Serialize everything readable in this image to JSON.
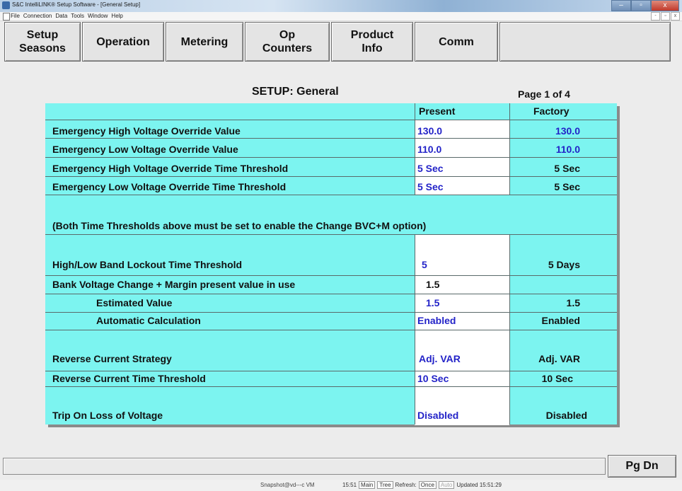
{
  "window": {
    "title": "S&C IntelliLINK® Setup Software - [General Setup]",
    "controls": [
      "–",
      "▫",
      "x"
    ]
  },
  "menu": {
    "items": [
      "File",
      "Connection",
      "Data",
      "Tools",
      "Window",
      "Help"
    ],
    "mdi_controls": [
      "-",
      "▫",
      "x"
    ]
  },
  "toolbar": {
    "buttons": [
      "Setup\nSeasons",
      "Operation",
      "Metering",
      "Op\nCounters",
      "Product\nInfo",
      "Comm",
      ""
    ]
  },
  "page": {
    "title": "SETUP: General",
    "page_indicator": "Page 1 of 4"
  },
  "table": {
    "col_present": "Present",
    "col_factory": "Factory",
    "rows": [
      {
        "label": "Emergency High Voltage Override Value",
        "present": "130.0",
        "factory": "130.0"
      },
      {
        "label": "Emergency Low Voltage Override Value",
        "present": "110.0",
        "factory": "110.0"
      },
      {
        "label": "Emergency High Voltage Override Time Threshold",
        "present": "5 Sec",
        "factory": "5 Sec"
      },
      {
        "label": "Emergency Low Voltage Override Time Threshold",
        "present": "5 Sec",
        "factory": "5 Sec"
      },
      {
        "label": "(Both Time Thresholds above must be set to enable the Change BVC+M option)"
      },
      {
        "label": "High/Low Band Lockout Time Threshold",
        "present": "5",
        "factory": "5 Days"
      },
      {
        "label": "Bank Voltage Change + Margin present value in use",
        "present": "1.5",
        "factory": ""
      },
      {
        "label": "Estimated Value",
        "present": "1.5",
        "factory": "1.5"
      },
      {
        "label": "Automatic Calculation",
        "present": "Enabled",
        "factory": "Enabled"
      },
      {
        "label": "Reverse Current Strategy",
        "present": "Adj. VAR",
        "factory": "Adj. VAR"
      },
      {
        "label": "Reverse Current Time Threshold",
        "present": "10 Sec",
        "factory": "10 Sec"
      },
      {
        "label": "Trip On Loss of Voltage",
        "present": "Disabled",
        "factory": "Disabled"
      }
    ]
  },
  "footer": {
    "status": "",
    "pgdn_label": "Pg Dn"
  },
  "bottom_bar": {
    "snapshot": "Snapshot@vd---c VM",
    "time": "15:51",
    "buttons": [
      "Main",
      "Tree",
      "Refresh:",
      "Once",
      "Auto"
    ],
    "updated": "Updated 15:51:29"
  }
}
